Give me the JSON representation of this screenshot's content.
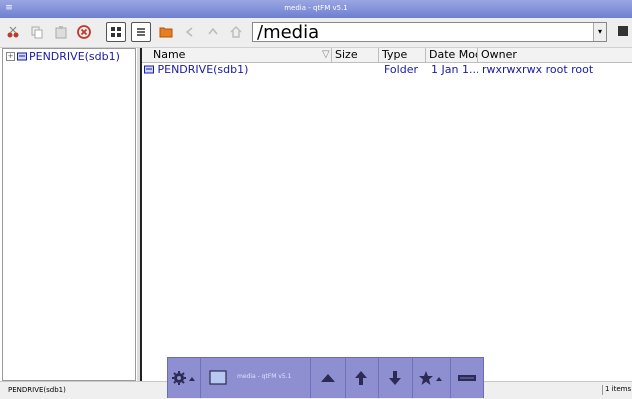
{
  "window": {
    "title": "media - qtFM v5.1"
  },
  "toolbar": {
    "path_value": "/media"
  },
  "tree": {
    "items": [
      {
        "label": "PENDRIVE(sdb1)"
      }
    ]
  },
  "list": {
    "columns": [
      "Name",
      "Size",
      "Type",
      "Date Mod",
      "Owner"
    ],
    "rows": [
      {
        "name": "PENDRIVE(sdb1)",
        "size": "",
        "type": "Folder",
        "date": "1 Jan 1...",
        "owner": "rwxrwxrwx root root"
      }
    ]
  },
  "dock": {
    "task_label": "media - qtFM v5.1"
  },
  "status": {
    "left": "PENDRIVE(sdb1)",
    "right": "1 items"
  },
  "colors": {
    "accent": "#1a1aa6",
    "dock": "#8e8fd1",
    "titlebar": "#6f7fcf"
  }
}
